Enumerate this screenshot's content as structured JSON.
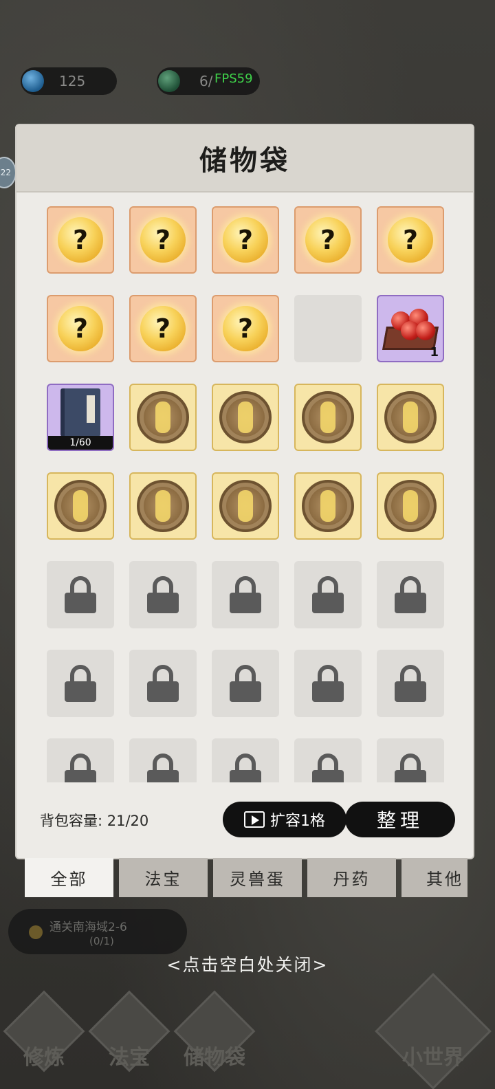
{
  "topbar": {
    "resource1": {
      "value": "125",
      "icon": "blue-gem-icon",
      "color": "#2c6fa3"
    },
    "resource2": {
      "value": "6/",
      "icon": "green-orb-plus-icon",
      "color": "#2f6d4a"
    },
    "fps": "FPS59",
    "side_badge": "22"
  },
  "panel": {
    "title": "储物袋",
    "slots": [
      {
        "type": "mystery",
        "label": "?"
      },
      {
        "type": "mystery",
        "label": "?"
      },
      {
        "type": "mystery",
        "label": "?"
      },
      {
        "type": "mystery",
        "label": "?"
      },
      {
        "type": "mystery",
        "label": "?"
      },
      {
        "type": "mystery",
        "label": "?"
      },
      {
        "type": "mystery",
        "label": "?"
      },
      {
        "type": "mystery",
        "label": "?"
      },
      {
        "type": "empty"
      },
      {
        "type": "beads",
        "qty": "1"
      },
      {
        "type": "book",
        "count": "1/60"
      },
      {
        "type": "medal"
      },
      {
        "type": "medal"
      },
      {
        "type": "medal"
      },
      {
        "type": "medal"
      },
      {
        "type": "medal"
      },
      {
        "type": "medal"
      },
      {
        "type": "medal"
      },
      {
        "type": "medal"
      },
      {
        "type": "medal"
      },
      {
        "type": "locked"
      },
      {
        "type": "locked"
      },
      {
        "type": "locked"
      },
      {
        "type": "locked"
      },
      {
        "type": "locked"
      },
      {
        "type": "locked"
      },
      {
        "type": "locked"
      },
      {
        "type": "locked"
      },
      {
        "type": "locked"
      },
      {
        "type": "locked"
      },
      {
        "type": "locked"
      },
      {
        "type": "locked"
      },
      {
        "type": "locked"
      },
      {
        "type": "locked"
      },
      {
        "type": "locked"
      }
    ],
    "capacity_text": "背包容量: 21/20",
    "expand_label": "扩容1格",
    "sort_label": "整理"
  },
  "tabs": [
    {
      "label": "全部",
      "active": true
    },
    {
      "label": "法宝",
      "active": false
    },
    {
      "label": "灵兽蛋",
      "active": false
    },
    {
      "label": "丹药",
      "active": false
    },
    {
      "label": "其他",
      "active": false
    }
  ],
  "quest": {
    "title": "通关南海域2-6",
    "progress": "(0/1)"
  },
  "hint": "<点击空白处关闭>",
  "nav": [
    {
      "label": "修炼",
      "icon": "cultivate-icon"
    },
    {
      "label": "法宝",
      "icon": "treasure-icon"
    },
    {
      "label": "储物袋",
      "icon": "bag-icon"
    },
    {
      "label": "小世界",
      "icon": "small-world-icon"
    }
  ]
}
